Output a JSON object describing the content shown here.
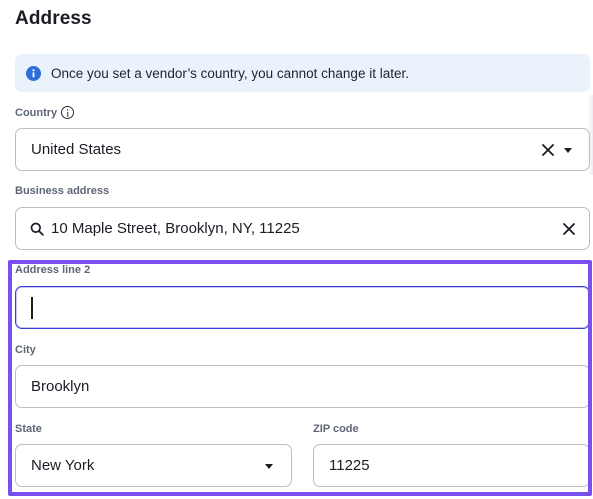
{
  "section": {
    "title": "Address"
  },
  "banner": {
    "icon": "info-icon",
    "text": "Once you set a vendor’s country, you cannot change it later.",
    "background": "#eaf2fb",
    "icon_color": "#2d6fd8"
  },
  "country": {
    "label": "Country",
    "value": "United States",
    "icons": [
      "info-icon",
      "clear-icon",
      "dropdown-arrow-icon"
    ]
  },
  "business_address": {
    "label": "Business address",
    "value": "10 Maple Street, Brooklyn, NY, 11225",
    "icons": [
      "search-icon",
      "clear-icon"
    ]
  },
  "address_line2": {
    "label": "Address line 2",
    "value": ""
  },
  "city": {
    "label": "City",
    "value": "Brooklyn"
  },
  "state": {
    "label": "State",
    "value": "New York",
    "icons": [
      "dropdown-arrow-icon"
    ]
  },
  "zip": {
    "label": "ZIP code",
    "value": "11225"
  },
  "colors": {
    "highlight": "#7a4ff0",
    "focus": "#3b3fd6"
  }
}
